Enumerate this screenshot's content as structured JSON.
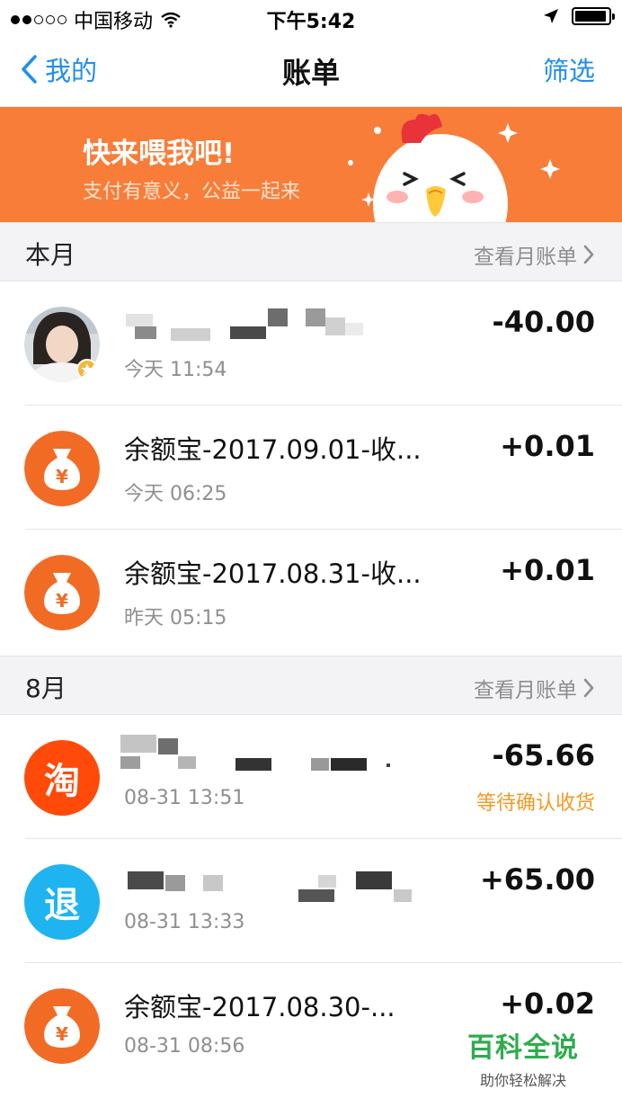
{
  "status_bar": {
    "carrier": "中国移动",
    "time": "下午5:42"
  },
  "nav": {
    "back_label": "我的",
    "title": "账单",
    "filter_label": "筛选"
  },
  "banner": {
    "headline": "快来喂我吧!",
    "subline": "支付有意义，公益一起来"
  },
  "sections": [
    {
      "label": "本月",
      "link": "查看月账单",
      "rows": [
        {
          "icon": "avatar-photo",
          "name": "",
          "time": "今天  11:54",
          "amount": "-40.00"
        },
        {
          "icon": "money-bag-icon",
          "name": "余额宝-2017.09.01-收...",
          "time": "今天  06:25",
          "amount": "+0.01"
        },
        {
          "icon": "money-bag-icon",
          "name": "余额宝-2017.08.31-收...",
          "time": "昨天  05:15",
          "amount": "+0.01"
        }
      ]
    },
    {
      "label": "8月",
      "link": "查看月账单",
      "rows": [
        {
          "icon": "taobao-icon",
          "icon_text": "淘",
          "name": "",
          "time": "08-31  13:51",
          "amount": "-65.66",
          "status": "等待确认收货"
        },
        {
          "icon": "refund-icon",
          "icon_text": "退",
          "name": "",
          "time": "08-31  13:33",
          "amount": "+65.00"
        },
        {
          "icon": "money-bag-icon",
          "name": "余额宝-2017.08.30-...",
          "time": "08-31  08:56",
          "amount": "+0.02"
        }
      ]
    }
  ],
  "colors": {
    "accent": "#1f8ef1",
    "banner": "#f87d39",
    "orange_icon": "#f26b25",
    "taobao": "#ff4a0a",
    "refund": "#1fb4f0",
    "pending": "#f29a24"
  },
  "watermark": {
    "brand": "百科全说",
    "tagline": "助你轻松解决"
  }
}
